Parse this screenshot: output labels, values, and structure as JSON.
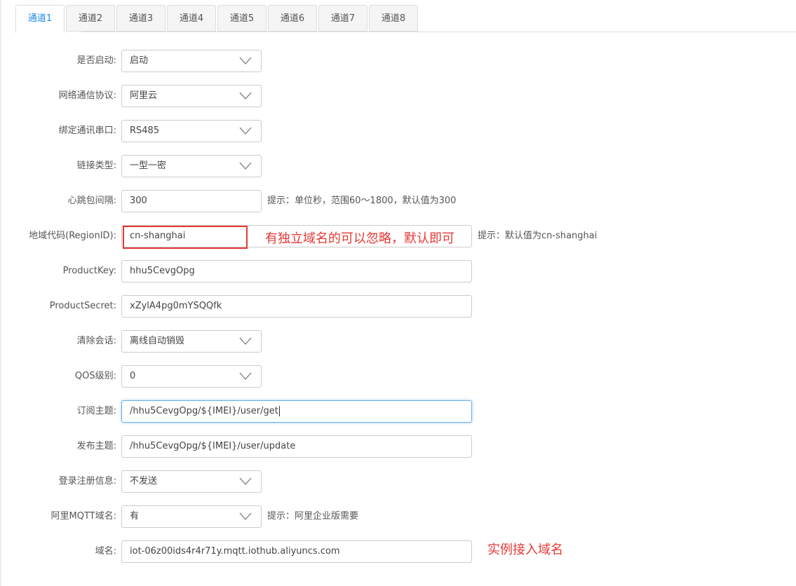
{
  "tabs": [
    "通道1",
    "通道2",
    "通道3",
    "通道4",
    "通道5",
    "通道6",
    "通道7",
    "通道8"
  ],
  "form": {
    "enable": {
      "label": "是否启动:",
      "value": "启动"
    },
    "protocol": {
      "label": "网络通信协议:",
      "value": "阿里云"
    },
    "serial": {
      "label": "绑定通讯串口:",
      "value": "RS485"
    },
    "link_type": {
      "label": "链接类型:",
      "value": "一型一密"
    },
    "heartbeat": {
      "label": "心跳包间隔:",
      "value": "300",
      "hint": "提示：单位秒，范围60～1800，默认值为300"
    },
    "region": {
      "label": "地域代码(RegionID):",
      "value": "cn-shanghai",
      "hint": "提示：默认值为cn-shanghai"
    },
    "product_key": {
      "label": "ProductKey:",
      "value": "hhu5CevgOpg"
    },
    "product_secret": {
      "label": "ProductSecret:",
      "value": "xZylA4pg0mYSQQfk"
    },
    "clear_session": {
      "label": "清除会话:",
      "value": "离线自动销毁"
    },
    "qos": {
      "label": "QOS级别:",
      "value": "0"
    },
    "subscribe": {
      "label": "订阅主题:",
      "value": "/hhu5CevgOpg/${IMEI}/user/get"
    },
    "publish": {
      "label": "发布主题:",
      "value": "/hhu5CevgOpg/${IMEI}/user/update"
    },
    "login_info": {
      "label": "登录注册信息:",
      "value": "不发送"
    },
    "ali_mqtt_domain": {
      "label": "阿里MQTT域名:",
      "value": "有",
      "hint": "提示：阿里企业版需要"
    },
    "domain": {
      "label": "域名:",
      "value": "iot-06z00ids4r4r71y.mqtt.iothub.aliyuncs.com"
    }
  },
  "annotations": {
    "region_note": "有独立域名的可以忽略，默认即可",
    "domain_note": "实例接入域名"
  },
  "colors": {
    "accent": "#1e88e5",
    "annotation": "#e53935"
  },
  "icons": {
    "select_arrow": "chevron-down-icon"
  }
}
